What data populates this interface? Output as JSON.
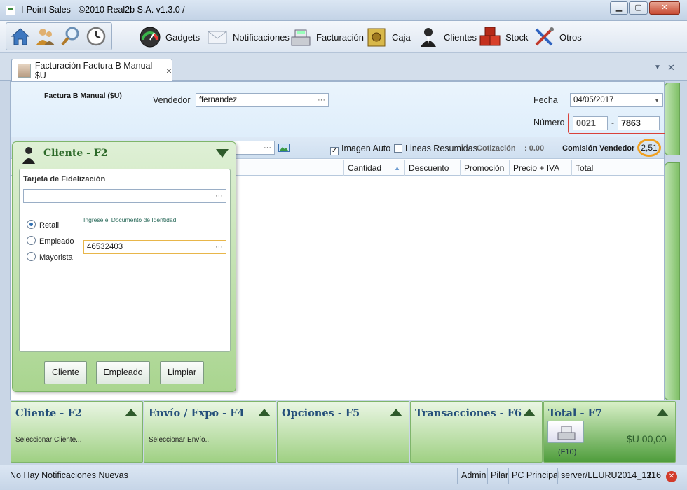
{
  "window": {
    "title": "I-Point Sales  - ©2010 Real2b S.A. v1.3.0 /",
    "minimize": "▁",
    "maximize": "▢",
    "close": "✕"
  },
  "toolbar": {
    "quick_icons": [
      "home-icon",
      "users-icon",
      "search-icon",
      "clock-icon"
    ],
    "items": [
      {
        "label": "Gadgets",
        "icon": "gauge-icon"
      },
      {
        "label": "Notificaciones",
        "icon": "envelope-icon"
      },
      {
        "label": "Facturación",
        "icon": "cash-register-icon"
      },
      {
        "label": "Caja",
        "icon": "safe-icon"
      },
      {
        "label": "Clientes",
        "icon": "person-icon"
      },
      {
        "label": "Stock",
        "icon": "boxes-icon"
      },
      {
        "label": "Otros",
        "icon": "tools-icon"
      }
    ]
  },
  "tab": {
    "label": "Facturación Factura B Manual $U",
    "close": "×"
  },
  "tabstrip_controls": {
    "dropdown": "▼",
    "close": "✕"
  },
  "header": {
    "doc_title": "Factura B Manual ($U)",
    "vendedor_label": "Vendedor",
    "vendedor_value": "ffernandez",
    "fecha_label": "Fecha",
    "fecha_value": "04/05/2017",
    "numero_label": "Número",
    "numero_prefix": "0021",
    "numero_sep": "-",
    "numero_value": "7863"
  },
  "options": {
    "imagen_auto": "Imagen Auto",
    "imagen_auto_checked": true,
    "lineas_resumidas": "Lineas Resumidas",
    "lineas_resumidas_checked": false,
    "cotizacion_label": "Cotización",
    "cotizacion_value": ": 0.00",
    "comision_label": "Comisión Vendedor",
    "comision_value": "2,51"
  },
  "grid": {
    "columns": [
      "Cantidad",
      "Descuento",
      "Promoción",
      "Precio + IVA",
      "Total"
    ]
  },
  "cliente_popup": {
    "title": "Cliente - F2",
    "tarjeta_label": "Tarjeta de Fidelización",
    "tarjeta_value": "",
    "doc_hint": "Ingrese el Documento de Identidad",
    "doc_value": "46532403",
    "radios": [
      {
        "label": "Retail",
        "selected": true
      },
      {
        "label": "Empleado",
        "selected": false
      },
      {
        "label": "Mayorista",
        "selected": false
      }
    ],
    "buttons": [
      "Cliente",
      "Empleado",
      "Limpiar"
    ]
  },
  "bottom": {
    "sections": [
      {
        "title": "Cliente - F2",
        "subtitle": "Seleccionar Cliente..."
      },
      {
        "title": "Envío / Expo - F4",
        "subtitle": "Seleccionar Envío..."
      },
      {
        "title": "Opciones - F5",
        "subtitle": ""
      },
      {
        "title": "Transacciones - F6",
        "subtitle": ""
      }
    ],
    "total": {
      "title": "Total - F7",
      "amount": "$U 00,00",
      "key": "(F10)"
    }
  },
  "status": {
    "notifications": "No Hay Notificaciones Nuevas",
    "user": "Admin",
    "name": "Pilar",
    "pc": "PC Principal",
    "server": "server/LEURU2014_12",
    "number": "116"
  },
  "colors": {
    "accent_green": "#7fb56b",
    "title_blue": "#244f7a",
    "numero_border": "#d9413a",
    "comision_ring": "#f0a020"
  }
}
